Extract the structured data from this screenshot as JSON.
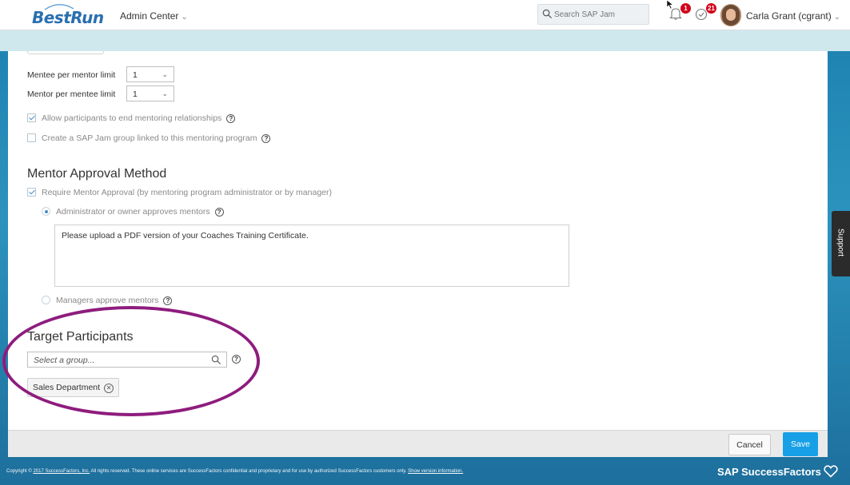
{
  "header": {
    "logo_text": "BestRun",
    "admin_center": "Admin Center",
    "search_placeholder": "Search SAP Jam",
    "notifications_count": "1",
    "todo_count": "21",
    "user_name": "Carla Grant (cgrant)"
  },
  "settings": {
    "mentee_limit_label": "Mentee per mentor limit",
    "mentee_limit_value": "1",
    "mentor_limit_label": "Mentor per mentee limit",
    "mentor_limit_value": "1",
    "allow_end_label": "Allow participants to end mentoring relationships",
    "allow_end_checked": true,
    "jam_group_label": "Create a SAP Jam group linked to this mentoring program",
    "jam_group_checked": false
  },
  "approval": {
    "title": "Mentor Approval Method",
    "require_label": "Require Mentor Approval (by mentoring program administrator or by manager)",
    "require_checked": true,
    "admin_option": "Administrator or owner approves mentors",
    "admin_selected": true,
    "instructions_text": "Please upload a PDF version of your Coaches Training Certificate.",
    "manager_option": "Managers approve mentors"
  },
  "target": {
    "title": "Target Participants",
    "group_placeholder": "Select a group...",
    "selected_group": "Sales Department"
  },
  "actions": {
    "cancel_label": "Cancel",
    "save_label": "Save"
  },
  "support_label": "Support",
  "footer": {
    "copyright_prefix": "Copyright © ",
    "copyright_link": "2017 SuccessFactors, Inc.",
    "copyright_text": " All rights reserved. These online services are SuccessFactors confidential and proprietary and for use by authorized SuccessFactors customers only. ",
    "version_link": "Show version information.",
    "brand": "SAP SuccessFactors"
  },
  "colors": {
    "accent": "#17a0e6",
    "highlight": "#8e1c7d",
    "badge": "#d0021b"
  }
}
